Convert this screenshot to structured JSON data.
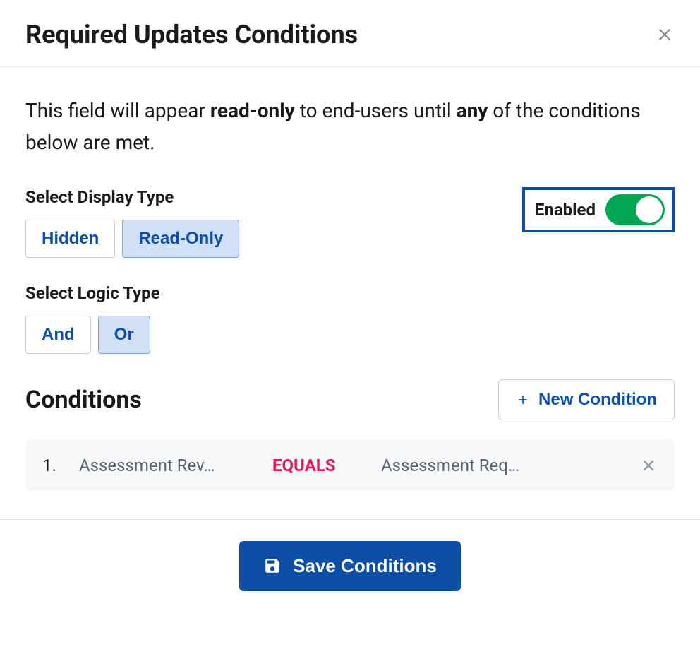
{
  "header": {
    "title": "Required Updates Conditions"
  },
  "description": {
    "prefix": "This field will appear ",
    "bold1": "read-only",
    "middle": " to end-users until ",
    "bold2": "any",
    "suffix": " of the conditions below are met."
  },
  "displayType": {
    "label": "Select Display Type",
    "options": [
      "Hidden",
      "Read-Only"
    ],
    "selected": 1
  },
  "logicType": {
    "label": "Select Logic Type",
    "options": [
      "And",
      "Or"
    ],
    "selected": 1
  },
  "enabled": {
    "label": "Enabled",
    "value": true
  },
  "conditions": {
    "heading": "Conditions",
    "newButton": "New Condition",
    "items": [
      {
        "number": "1.",
        "field": "Assessment Rev…",
        "operator": "EQUALS",
        "value": "Assessment Req…"
      }
    ]
  },
  "footer": {
    "saveButton": "Save Conditions"
  }
}
